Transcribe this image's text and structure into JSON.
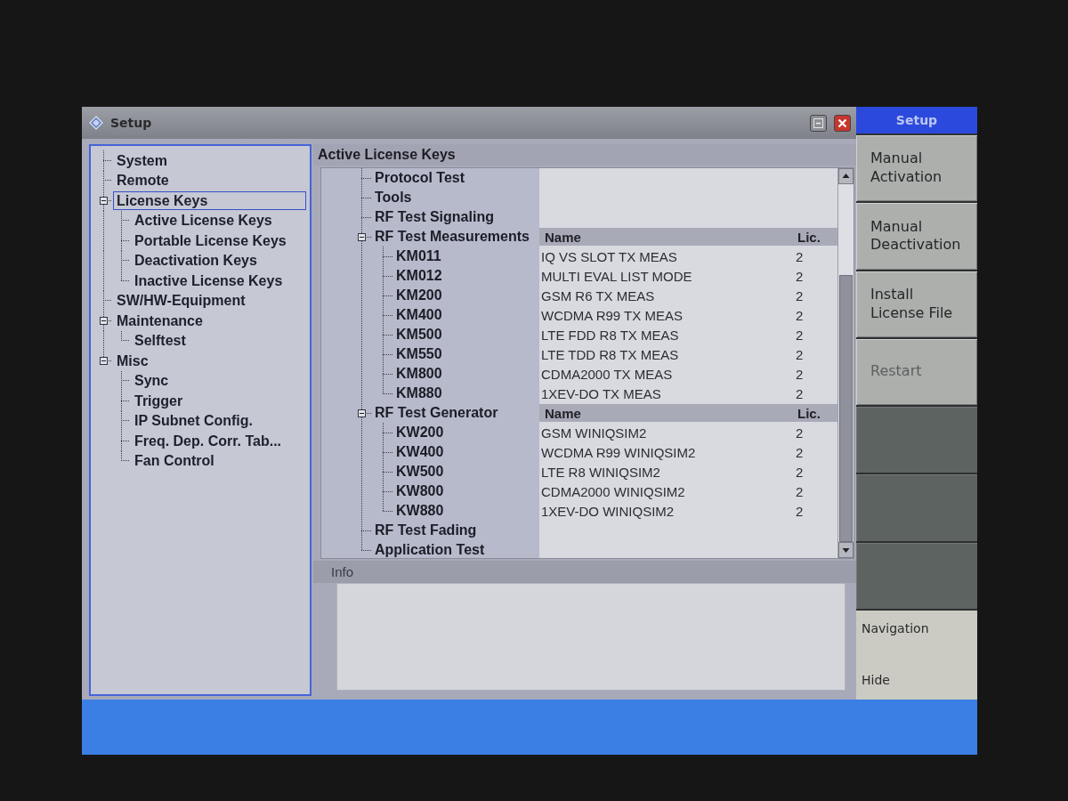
{
  "window": {
    "title": "Setup"
  },
  "nav_tree": [
    {
      "label": "System",
      "selected": false
    },
    {
      "label": "Remote",
      "selected": false
    },
    {
      "label": "License Keys",
      "selected": true,
      "expanded": true,
      "children": [
        {
          "label": "Active License Keys",
          "selected": false
        },
        {
          "label": "Portable License Keys",
          "selected": false
        },
        {
          "label": "Deactivation Keys",
          "selected": false
        },
        {
          "label": "Inactive License Keys",
          "selected": false
        }
      ]
    },
    {
      "label": "SW/HW-Equipment",
      "selected": false
    },
    {
      "label": "Maintenance",
      "selected": false,
      "expanded": true,
      "children": [
        {
          "label": "Selftest",
          "selected": false
        }
      ]
    },
    {
      "label": "Misc",
      "selected": false,
      "expanded": true,
      "children": [
        {
          "label": "Sync",
          "selected": false
        },
        {
          "label": "Trigger",
          "selected": false
        },
        {
          "label": "IP Subnet Config.",
          "selected": false
        },
        {
          "label": "Freq. Dep. Corr. Tab...",
          "selected": false
        },
        {
          "label": "Fan Control",
          "selected": false
        }
      ]
    }
  ],
  "content": {
    "title": "Active License Keys",
    "tree": [
      {
        "label": "Protocol Test"
      },
      {
        "label": "Tools"
      },
      {
        "label": "RF Test Signaling"
      },
      {
        "label": "RF Test Measurements",
        "expanded": true,
        "columns": [
          "Name",
          "Lic."
        ],
        "children": [
          {
            "label": "KM011",
            "cells": [
              "IQ VS SLOT TX MEAS",
              "2"
            ]
          },
          {
            "label": "KM012",
            "cells": [
              "MULTI EVAL LIST MODE",
              "2"
            ]
          },
          {
            "label": "KM200",
            "cells": [
              "GSM R6 TX MEAS",
              "2"
            ]
          },
          {
            "label": "KM400",
            "cells": [
              "WCDMA R99 TX MEAS",
              "2"
            ]
          },
          {
            "label": "KM500",
            "cells": [
              "LTE FDD R8 TX MEAS",
              "2"
            ]
          },
          {
            "label": "KM550",
            "cells": [
              "LTE TDD R8 TX MEAS",
              "2"
            ]
          },
          {
            "label": "KM800",
            "cells": [
              "CDMA2000 TX MEAS",
              "2"
            ]
          },
          {
            "label": "KM880",
            "cells": [
              "1XEV-DO TX MEAS",
              "2"
            ]
          }
        ]
      },
      {
        "label": "RF Test Generator",
        "expanded": true,
        "columns": [
          "Name",
          "Lic."
        ],
        "children": [
          {
            "label": "KW200",
            "cells": [
              "GSM WINIQSIM2",
              "2"
            ]
          },
          {
            "label": "KW400",
            "cells": [
              "WCDMA R99 WINIQSIM2",
              "2"
            ]
          },
          {
            "label": "KW500",
            "cells": [
              "LTE R8 WINIQSIM2",
              "2"
            ]
          },
          {
            "label": "KW800",
            "cells": [
              "CDMA2000 WINIQSIM2",
              "2"
            ]
          },
          {
            "label": "KW880",
            "cells": [
              "1XEV-DO WINIQSIM2",
              "2"
            ]
          }
        ]
      },
      {
        "label": "RF Test Fading"
      },
      {
        "label": "Application Test"
      }
    ],
    "info": {
      "title": "Info"
    }
  },
  "softkey_panel": {
    "title": "Setup",
    "softkeys": [
      {
        "kind": "action",
        "label": "Manual Activation",
        "disabled": false
      },
      {
        "kind": "action",
        "label": "Manual Deactivation",
        "disabled": false
      },
      {
        "kind": "action",
        "label": "Install License File",
        "disabled": false
      },
      {
        "kind": "action",
        "label": "Restart",
        "disabled": true
      },
      {
        "kind": "empty"
      },
      {
        "kind": "empty"
      },
      {
        "kind": "empty"
      },
      {
        "kind": "toggle",
        "label": "Navigation",
        "value": "Hide"
      }
    ]
  }
}
